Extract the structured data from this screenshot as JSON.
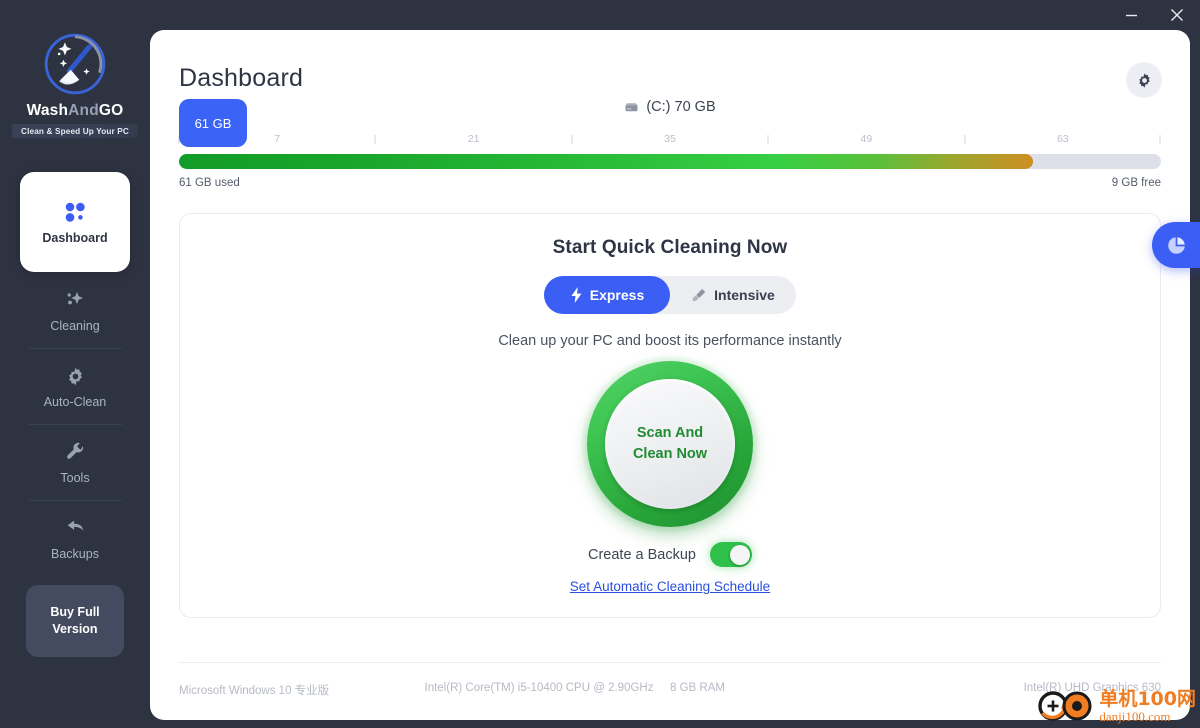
{
  "window": {
    "minimize_label": "Minimize",
    "close_label": "Close"
  },
  "brand": {
    "name_part1": "Wash",
    "name_part2": "And",
    "name_part3": "GO",
    "tagline": "Clean & Speed Up Your PC",
    "logo_icon": "broom-sparkle-icon"
  },
  "sidebar": {
    "items": [
      {
        "label": "Dashboard",
        "icon": "grid-dots-icon",
        "active": true
      },
      {
        "label": "Cleaning",
        "icon": "sparkle-icon",
        "active": false
      },
      {
        "label": "Auto-Clean",
        "icon": "gear-icon",
        "active": false
      },
      {
        "label": "Tools",
        "icon": "wrench-icon",
        "active": false
      },
      {
        "label": "Backups",
        "icon": "undo-arrow-icon",
        "active": false
      }
    ],
    "buy_button": "Buy Full\nVersion",
    "buy_button_line1": "Buy Full",
    "buy_button_line2": "Version"
  },
  "header": {
    "title": "Dashboard",
    "settings_icon": "gear-icon"
  },
  "disk": {
    "drive_icon": "hard-drive-icon",
    "drive_label": "(C:) 70 GB",
    "used_badge": "61 GB",
    "used_legend": "61 GB used",
    "free_legend": "9 GB free",
    "used_percent": 87,
    "ticks": [
      {
        "label": "7",
        "pos": 10
      },
      {
        "label": "21",
        "pos": 30
      },
      {
        "label": "35",
        "pos": 50
      },
      {
        "label": "49",
        "pos": 70
      },
      {
        "label": "63",
        "pos": 90
      }
    ],
    "marks": [
      0,
      20,
      40,
      60,
      80,
      100
    ]
  },
  "card": {
    "title": "Start Quick Cleaning Now",
    "tabs": [
      {
        "label": "Express",
        "icon": "lightning-bolt-icon",
        "selected": true
      },
      {
        "label": "Intensive",
        "icon": "brush-icon",
        "selected": false
      }
    ],
    "subtitle": "Clean up your PC and boost its performance instantly",
    "scan_button_line1": "Scan And",
    "scan_button_line2": "Clean Now",
    "backup_label": "Create a Backup",
    "backup_enabled": true,
    "schedule_link": "Set Automatic Cleaning Schedule"
  },
  "footer": {
    "os": "Microsoft Windows 10 专业版",
    "cpu": "Intel(R) Core(TM) i5-10400 CPU @ 2.90GHz",
    "ram": "8 GB RAM",
    "gpu": "Intel(R) UHD Graphics 630"
  },
  "side_tab": {
    "icon": "pie-chart-icon"
  },
  "watermark": {
    "cn": "单机100网",
    "url": "danji100.com"
  },
  "colors": {
    "app_bg": "#2e3342",
    "accent_blue": "#3b5ef5",
    "green": "#2fc04a",
    "orange": "#cf8e22",
    "panel": "#ffffff"
  }
}
